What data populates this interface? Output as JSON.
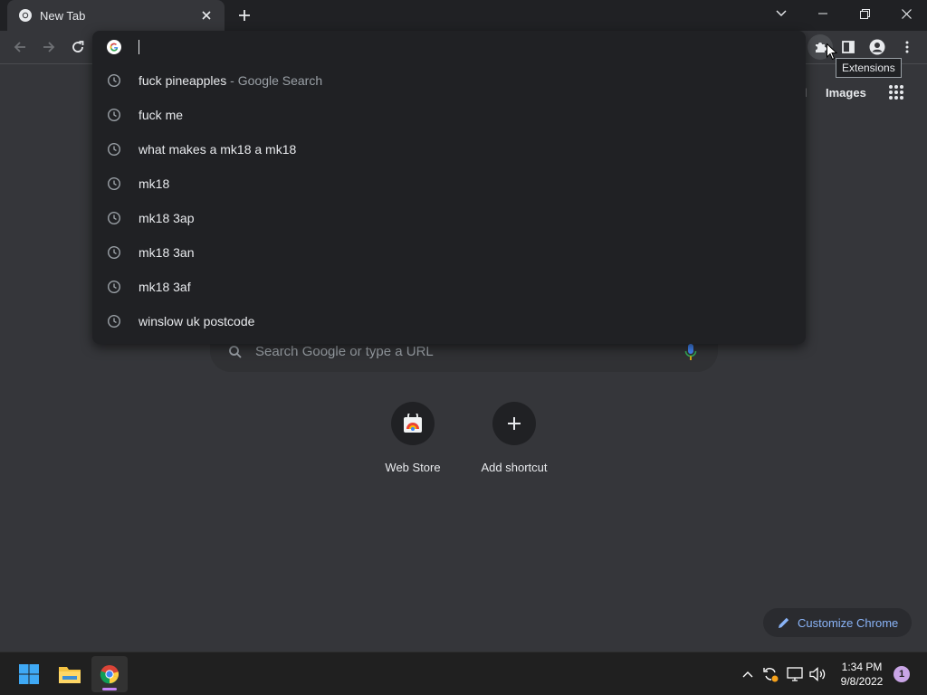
{
  "tab": {
    "title": "New Tab"
  },
  "tooltip": {
    "text": "Extensions"
  },
  "omnibox": {
    "value": "",
    "suggestions": [
      {
        "text": "fuck pineapples",
        "sub": " - Google Search",
        "icon": "history-icon"
      },
      {
        "text": "fuck me",
        "sub": "",
        "icon": "history-icon"
      },
      {
        "text": "what makes a mk18 a mk18",
        "sub": "",
        "icon": "history-icon"
      },
      {
        "text": "mk18",
        "sub": "",
        "icon": "history-icon"
      },
      {
        "text": "mk18 3ap",
        "sub": "",
        "icon": "history-icon"
      },
      {
        "text": "mk18 3an",
        "sub": "",
        "icon": "history-icon"
      },
      {
        "text": "mk18 3af",
        "sub": "",
        "icon": "history-icon"
      },
      {
        "text": "winslow uk postcode",
        "sub": "",
        "icon": "history-icon"
      }
    ]
  },
  "ntp": {
    "gmail_partial": "il",
    "images": "Images",
    "search_placeholder": "Search Google or type a URL",
    "shortcuts": [
      {
        "label": "Web Store",
        "icon": "web-store-icon"
      },
      {
        "label": "Add shortcut",
        "icon": "plus-icon"
      }
    ],
    "customize_label": "Customize Chrome"
  },
  "taskbar": {
    "time": "1:34 PM",
    "date": "9/8/2022",
    "notification_count": "1"
  },
  "colors": {
    "background": "#35363a",
    "frame": "#202124",
    "accent_link": "#8ab4f8",
    "taskbar": "#202020"
  }
}
